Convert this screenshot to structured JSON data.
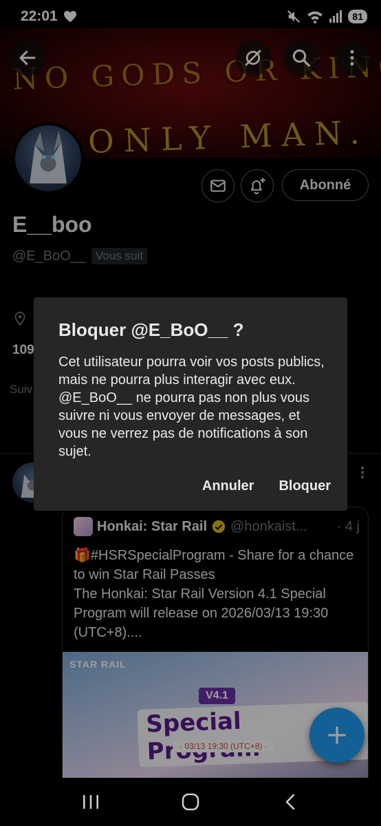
{
  "status_bar": {
    "time": "22:01",
    "battery": "81"
  },
  "banner": {
    "line1": "NO GODS OR KINGS",
    "line2": "ONLY MAN."
  },
  "profile": {
    "display_name": "E__boo",
    "handle": "@E_BoO__",
    "follows_you": "Vous suit",
    "follow_button": "Abonné",
    "stat_fragment": "109",
    "tab_fragment": "Suiv"
  },
  "dialog": {
    "title": "Bloquer @E_BoO__ ?",
    "body": "Cet utilisateur pourra voir vos posts publics, mais ne pourra plus interagir avec eux. @E_BoO__ ne pourra pas non plus vous suivre ni vous envoyer de messages, et vous ne verrez pas de notifications à son sujet.",
    "cancel": "Annuler",
    "confirm": "Bloquer"
  },
  "quote": {
    "name": "Honkai: Star Rail",
    "handle": "@honkaist...",
    "time": "· 4 j",
    "text_line1": "🎁#HSRSpecialProgram - Share for a chance to win Star Rail Passes",
    "text_line2": "The Honkai: Star Rail Version 4.1 Special Program will release on 2026/03/13 19:30 (UTC+8)....",
    "image_logo": "STAR RAIL",
    "image_badge": "V4.1",
    "image_title": "Special Program",
    "image_date": "· 03/13 19:30 (UTC+8) ·"
  },
  "colors": {
    "accent": "#1d9bf0",
    "dialog_bg": "#262626",
    "banner_text": "#f0b21a"
  }
}
